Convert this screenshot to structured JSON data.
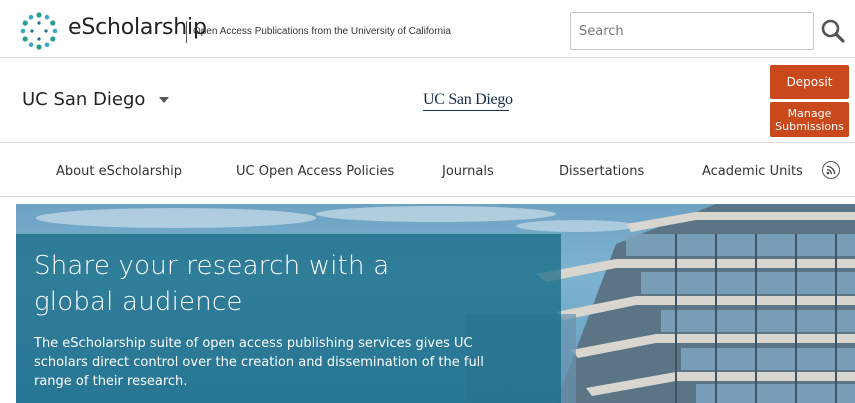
{
  "header": {
    "logo_text": "eScholarship",
    "tagline": "Open Access Publications from the University of California",
    "search_placeholder": "Search",
    "icons": {
      "logo": "escholarship-logo-icon",
      "search": "search-icon"
    }
  },
  "campus": {
    "name": "UC San Diego",
    "logo_text": "UC San Diego",
    "deposit_label": "Deposit",
    "manage_label": "Manage Submissions",
    "colors": {
      "button": "#c9481c",
      "logo": "#182b49"
    }
  },
  "nav": {
    "items": [
      {
        "label": "About eScholarship"
      },
      {
        "label": "UC Open Access Policies"
      },
      {
        "label": "Journals"
      },
      {
        "label": "Dissertations"
      },
      {
        "label": "Academic Units"
      }
    ],
    "rss_icon": "rss-icon"
  },
  "hero": {
    "title": "Share your research with a global audience",
    "body": "The eScholarship suite of open access publishing services gives UC scholars direct control over the creation and dissemination of the full range of their research."
  }
}
